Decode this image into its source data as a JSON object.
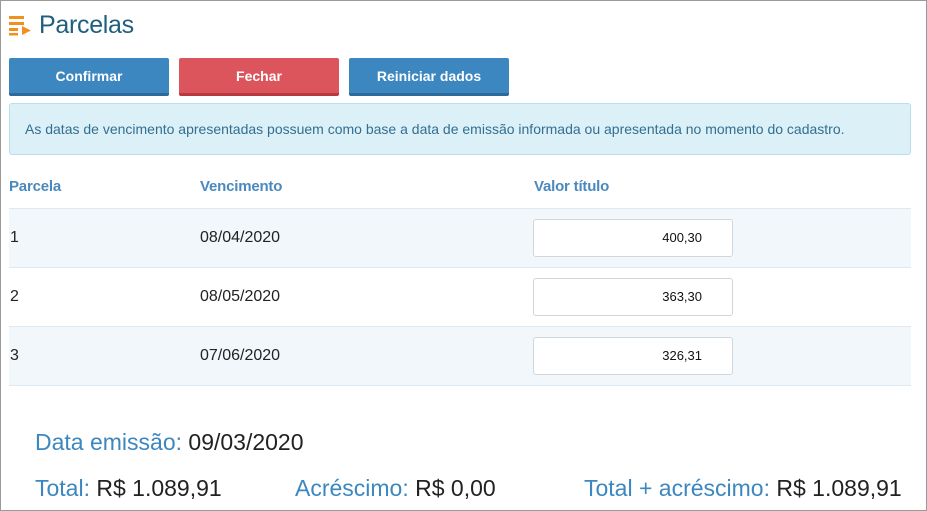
{
  "header": {
    "title": "Parcelas",
    "icon": "list-arrow-icon",
    "icon_color": "#f0901e"
  },
  "buttons": {
    "confirm": "Confirmar",
    "close": "Fechar",
    "reset": "Reiniciar dados"
  },
  "alert": {
    "message": "As datas de vencimento apresentadas possuem como base a data de emissão informada ou apresentada no momento do cadastro."
  },
  "table": {
    "headers": {
      "parcela": "Parcela",
      "vencimento": "Vencimento",
      "valor": "Valor título"
    },
    "rows": [
      {
        "parcela": "1",
        "vencimento": "08/04/2020",
        "valor": "400,30"
      },
      {
        "parcela": "2",
        "vencimento": "08/05/2020",
        "valor": "363,30"
      },
      {
        "parcela": "3",
        "vencimento": "07/06/2020",
        "valor": "326,31"
      }
    ]
  },
  "summary": {
    "emissao_label": "Data emissão:",
    "emissao_value": "09/03/2020",
    "total_label": "Total:",
    "total_value": "R$ 1.089,91",
    "acrescimo_label": "Acréscimo:",
    "acrescimo_value": "R$ 0,00",
    "total_acrescimo_label": "Total + acréscimo:",
    "total_acrescimo_value": "R$ 1.089,91"
  },
  "colors": {
    "accent_blue": "#3d87c0",
    "danger_red": "#dc555c",
    "title": "#1f5f7e"
  }
}
